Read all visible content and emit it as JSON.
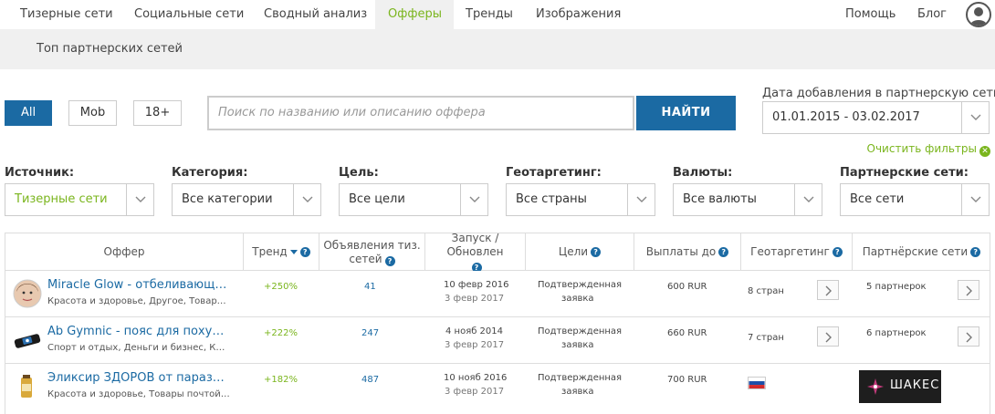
{
  "topnav": {
    "items": [
      {
        "label": "Тизерные сети"
      },
      {
        "label": "Социальные сети"
      },
      {
        "label": "Сводный анализ"
      },
      {
        "label": "Офферы"
      },
      {
        "label": "Тренды"
      },
      {
        "label": "Изображения"
      }
    ],
    "active_index": 3,
    "help": "Помощь",
    "blog": "Блог"
  },
  "subnav": {
    "item": "Топ партнерских сетей"
  },
  "filters": {
    "buttons": [
      "All",
      "Mob",
      "18+"
    ],
    "search_placeholder": "Поиск по названию или описанию оффера",
    "find_label": "НАЙТИ",
    "date_label": "Дата добавления в партнерскую сеть",
    "date_value": "01.01.2015 - 03.02.2017",
    "clear_label": "Очистить фильтры",
    "selects": [
      {
        "label": "Источник:",
        "value": "Тизерные сети"
      },
      {
        "label": "Категория:",
        "value": "Все категории"
      },
      {
        "label": "Цель:",
        "value": "Все цели"
      },
      {
        "label": "Геотаргетинг:",
        "value": "Все страны"
      },
      {
        "label": "Валюты:",
        "value": "Все валюты"
      },
      {
        "label": "Партнерские сети:",
        "value": "Все сети"
      }
    ]
  },
  "table": {
    "headers": {
      "offer": "Оффер",
      "trend": "Тренд",
      "ads": "Объявления тиз. сетей",
      "launch": "Запуск / Обновлен",
      "goals": "Цели",
      "payouts": "Выплаты до",
      "geo": "Геотаргетинг",
      "networks": "Партнёрские сети"
    },
    "rows": [
      {
        "title": "Miracle Glow - отбеливающа...",
        "categories": "Красота и здоровье, Другое, Товары ...",
        "trend": "+250%",
        "ads": "41",
        "launch": "10 февр 2016",
        "updated": "3 февр 2017",
        "goal_line1": "Подтвержденная",
        "goal_line2": "заявка",
        "payout": "600 RUR",
        "geo": "8 стран",
        "networks": "5 партнерок"
      },
      {
        "title": "Ab Gymnic - пояс для похуд...",
        "categories": "Спорт и отдых, Деньги и бизнес, Кра...",
        "trend": "+222%",
        "ads": "247",
        "launch": "4 нояб 2014",
        "updated": "3 февр 2017",
        "goal_line1": "Подтвержденная",
        "goal_line2": "заявка",
        "payout": "660 RUR",
        "geo": "7 стран",
        "networks": "6 партнерок"
      },
      {
        "title": "Эликсир ЗДОРОВ от паразит...",
        "categories": "Красота и здоровье, Товары почтой -...",
        "trend": "+182%",
        "ads": "487",
        "launch": "10 нояб 2016",
        "updated": "3 февр 2017",
        "goal_line1": "Подтвержденная",
        "goal_line2": "заявка",
        "payout": "700 RUR",
        "network_logo": "ШАКЕС"
      }
    ]
  },
  "colors": {
    "accent_green": "#7ab51d",
    "primary_blue": "#1b6aa3"
  }
}
